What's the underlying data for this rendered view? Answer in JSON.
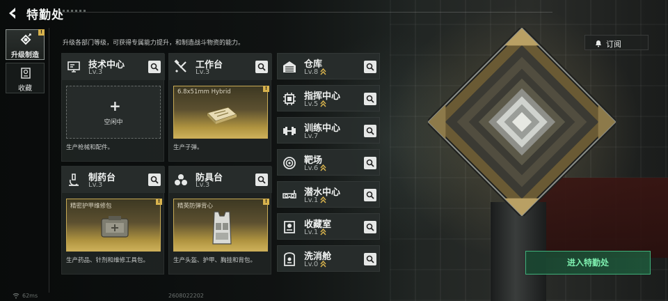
{
  "header": {
    "title": "特勤处"
  },
  "subtitle": "升级各部门等级，可获得专属能力提升，和制造战斗物资的能力。",
  "rail": {
    "items": [
      {
        "label": "升级制造",
        "active": true,
        "icon": "upgrade-icon"
      },
      {
        "label": "收藏",
        "active": false,
        "icon": "collection-icon"
      }
    ]
  },
  "cards": {
    "tech": {
      "name": "技术中心",
      "level": "Lv.3",
      "slot_text": "空闲中",
      "desc": "生产枪械和配件。",
      "icon": "monitor-icon"
    },
    "workbench": {
      "name": "工作台",
      "level": "Lv.3",
      "slot_label": "6.8x51mm Hybrid",
      "desc": "生产子弹。",
      "icon": "tools-icon"
    },
    "pharmacy": {
      "name": "制药台",
      "level": "Lv.3",
      "slot_label": "精密护甲维修包",
      "desc": "生产药品、针剂和维修工具包。",
      "icon": "microscope-icon"
    },
    "armor": {
      "name": "防具台",
      "level": "Lv.3",
      "slot_label": "精英防弹背心",
      "desc": "生产头盔、护甲、胸挂和背包。",
      "icon": "armor-icon"
    }
  },
  "facilities": [
    {
      "name": "仓库",
      "level": "Lv.8",
      "icon": "warehouse-icon",
      "upgradable": true
    },
    {
      "name": "指挥中心",
      "level": "Lv.5",
      "icon": "chip-icon",
      "upgradable": true
    },
    {
      "name": "训练中心",
      "level": "Lv.7",
      "icon": "dumbbell-icon",
      "upgradable": false
    },
    {
      "name": "靶场",
      "level": "Lv.6",
      "icon": "target-icon",
      "upgradable": true
    },
    {
      "name": "潜水中心",
      "level": "Lv.1",
      "icon": "diving-mask-icon",
      "upgradable": true
    },
    {
      "name": "收藏室",
      "level": "Lv.1",
      "icon": "badge-icon",
      "upgradable": true
    },
    {
      "name": "洗消舱",
      "level": "Lv.0",
      "icon": "decon-icon",
      "upgradable": true
    }
  ],
  "subscribe_label": "订阅",
  "enter_label": "进入特勤处",
  "footer": {
    "ping": "62ms",
    "id": "2608022202"
  },
  "colors": {
    "accent_gold": "#d7b24d",
    "enter_green": "#3fb07a",
    "upgrade_arrow": "#d7b24d"
  }
}
